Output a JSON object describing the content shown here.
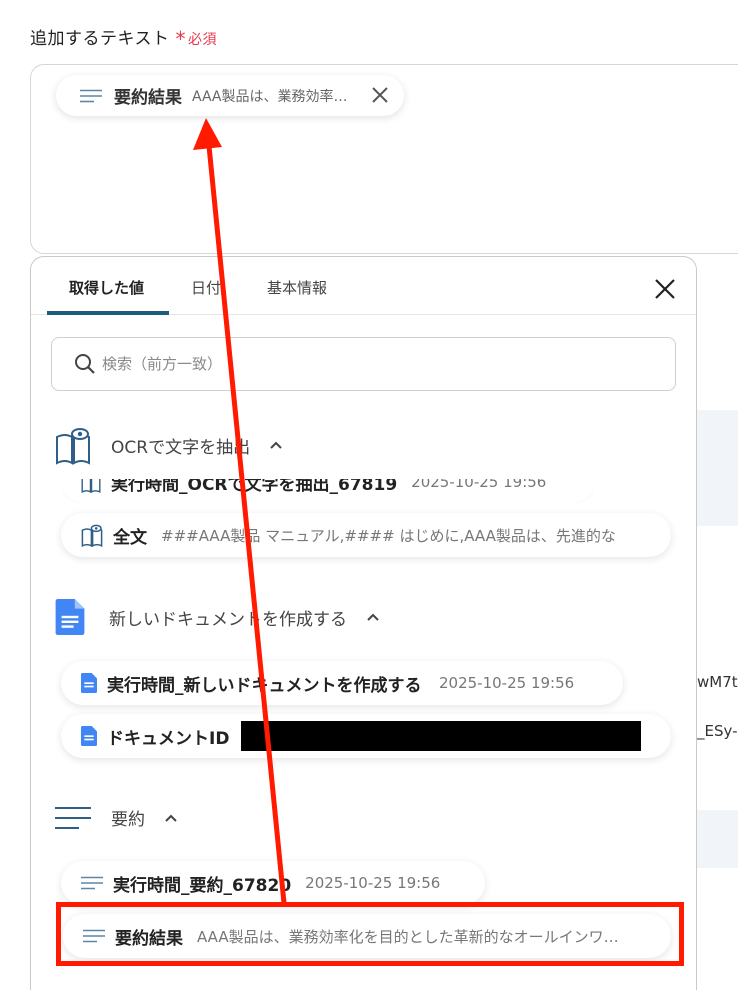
{
  "field": {
    "label": "追加するテキスト",
    "required_mark": "*",
    "required_text": "必須"
  },
  "chip": {
    "icon": "lines-icon",
    "title": "要約結果",
    "preview": "AAA製品は、業務効率化を目的とした革新的なオールインワンソリューション"
  },
  "background_text": [
    "wM7t",
    "_ESy-"
  ],
  "popup": {
    "tabs": [
      {
        "label": "取得した値",
        "active": true
      },
      {
        "label": "日付",
        "active": false
      },
      {
        "label": "基本情報",
        "active": false
      }
    ],
    "search_placeholder": "検索（前方一致）",
    "sections": [
      {
        "name": "OCRで文字を抽出",
        "icon": "ocr-book-icon",
        "items": [
          {
            "label": "実行時間_OCRで文字を抽出_67819",
            "value": "2025-10-25 19:56"
          },
          {
            "label": "全文",
            "value": "###AAA製品 マニュアル,#### はじめに,AAA製品は、先進的な"
          }
        ]
      },
      {
        "name": "新しいドキュメントを作成する",
        "icon": "google-docs-icon",
        "items": [
          {
            "label": "実行時間_新しいドキュメントを作成する",
            "value": "2025-10-25 19:56"
          },
          {
            "label": "ドキュメントID",
            "value": ""
          }
        ]
      },
      {
        "name": "要約",
        "icon": "summary-lines-icon",
        "items": [
          {
            "label": "実行時間_要約_67820",
            "value": "2025-10-25 19:56"
          },
          {
            "label": "要約結果",
            "value": "AAA製品は、業務効率化を目的とした革新的なオールインワンソリューション"
          }
        ]
      }
    ]
  },
  "colors": {
    "accent": "#1d5c7a",
    "required": "#e8384f",
    "annotation": "#ff1a00",
    "docs_blue": "#4285f4"
  }
}
